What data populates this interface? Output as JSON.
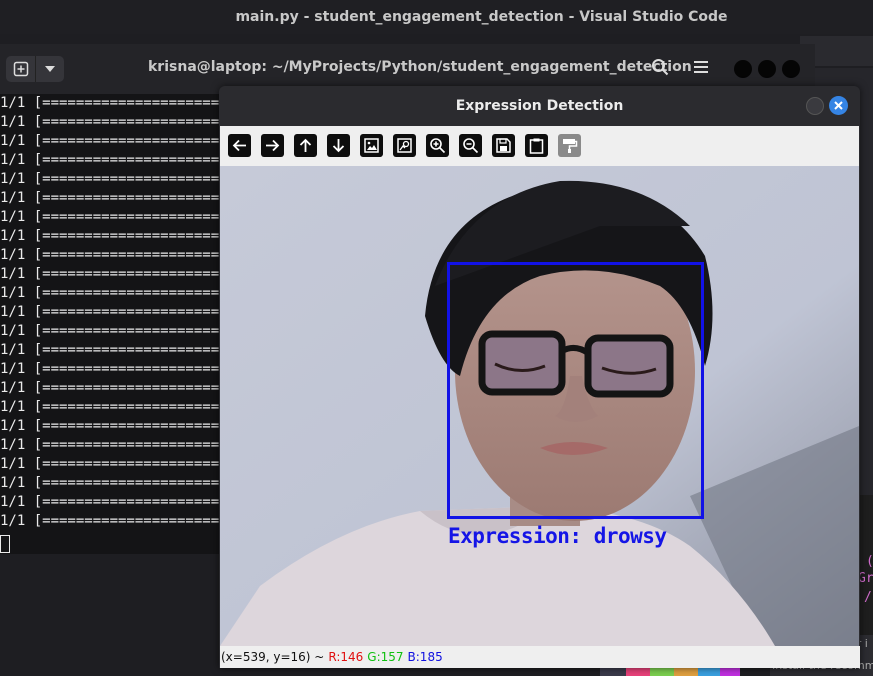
{
  "vscode": {
    "title": "main.py - student_engagement_detection - Visual Studio Code",
    "code_fragments": [
      "(",
      "Gr",
      "/"
    ],
    "notification": [
      "er i",
      "Install the recomm"
    ]
  },
  "terminal": {
    "title": "krisna@laptop: ~/MyProjects/Python/student_engagement_detection",
    "new_tab_icon": "plus-icon",
    "dropdown_icon": "chevron-down-icon",
    "lines": [
      "1/1 [==================================",
      "1/1 [==================================",
      "1/1 [==================================",
      "1/1 [==================================",
      "1/1 [==================================",
      "1/1 [==================================",
      "1/1 [==================================",
      "1/1 [==================================",
      "1/1 [==================================",
      "1/1 [==================================",
      "1/1 [==================================",
      "1/1 [==================================",
      "1/1 [==================================",
      "1/1 [==================================",
      "1/1 [==================================",
      "1/1 [==================================",
      "1/1 [==================================",
      "1/1 [==================================",
      "1/1 [==================================",
      "1/1 [==================================",
      "1/1 [==================================",
      "1/1 [==================================",
      "1/1 [=================================="
    ]
  },
  "expression_window": {
    "title": "Expression Detection",
    "toolbar": [
      {
        "name": "pan-left-button",
        "glyph": "←"
      },
      {
        "name": "pan-right-button",
        "glyph": "→"
      },
      {
        "name": "pan-up-button",
        "glyph": "↑"
      },
      {
        "name": "pan-down-button",
        "glyph": "↓"
      },
      {
        "name": "zoom-image-button",
        "glyph": "▣"
      },
      {
        "name": "zoom-fit-button",
        "glyph": "⊡"
      },
      {
        "name": "zoom-in-button",
        "glyph": "⊕"
      },
      {
        "name": "zoom-out-button",
        "glyph": "⊖"
      },
      {
        "name": "save-button",
        "glyph": "▤"
      },
      {
        "name": "copy-button",
        "glyph": "▭"
      },
      {
        "name": "properties-button",
        "glyph": "▦"
      }
    ],
    "label": "Expression: drowsy",
    "status": {
      "coords": "(x=539, y=16) ~",
      "r": "R:146",
      "g": "G:157",
      "b": "B:185"
    }
  },
  "colors": {
    "box": "#1212e6",
    "status_r": "#e01010",
    "status_g": "#10c010",
    "status_b": "#1010e0"
  }
}
